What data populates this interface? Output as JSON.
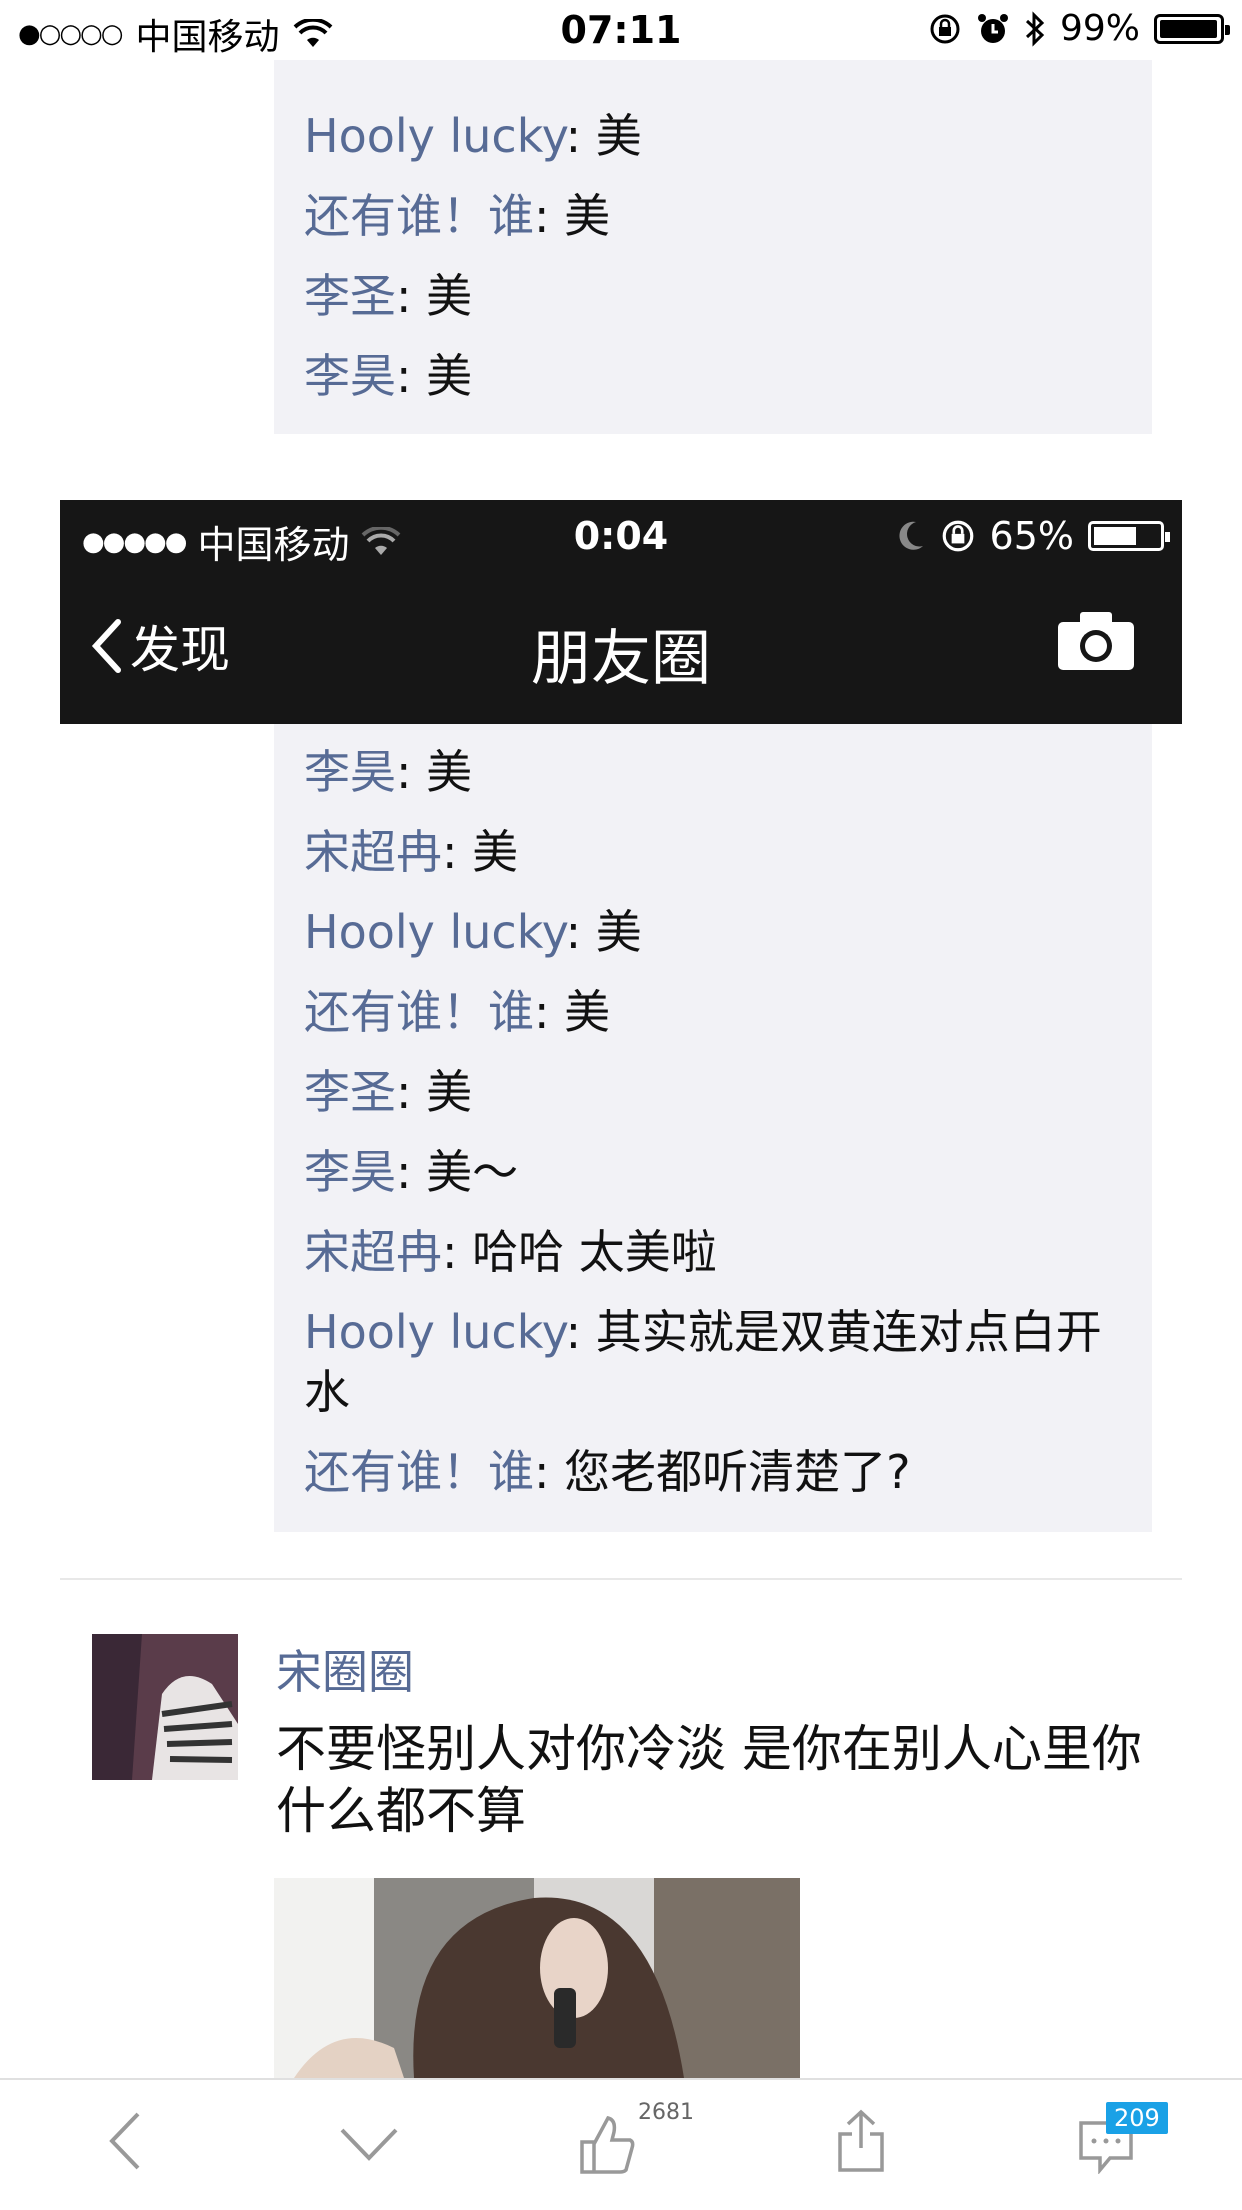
{
  "status_bar": {
    "signal": "●○○○○",
    "carrier": "中国移动",
    "time": "07:11",
    "battery": "99%",
    "battery_level": 0.99
  },
  "top_comments": [
    {
      "name": "Hooly lucky",
      "sep": ": ",
      "text": "美"
    },
    {
      "name": "还有谁！谁",
      "sep": ": ",
      "text": "美"
    },
    {
      "name": "李圣",
      "sep": ": ",
      "text": "美"
    },
    {
      "name": "李昊",
      "sep": ": ",
      "text": "美"
    }
  ],
  "inner_screen": {
    "signal": "●●●●●",
    "carrier": "中国移动",
    "time": "0:04",
    "battery": "65%",
    "battery_level": 0.65,
    "back_label": "发现",
    "title": "朋友圈"
  },
  "inner_comments": [
    {
      "name": "李昊",
      "sep": ": ",
      "text": "美"
    },
    {
      "name": "宋超冉",
      "sep": ": ",
      "text": "美"
    },
    {
      "name": "Hooly lucky",
      "sep": ": ",
      "text": "美"
    },
    {
      "name": "还有谁！谁",
      "sep": ": ",
      "text": "美"
    },
    {
      "name": "李圣",
      "sep": ": ",
      "text": "美"
    },
    {
      "name": "李昊",
      "sep": ": ",
      "text": "美～"
    },
    {
      "name": "宋超冉",
      "sep": ": ",
      "text": "哈哈 太美啦"
    },
    {
      "name": "Hooly lucky",
      "sep": ": ",
      "text": "其实就是双黄连对点白开水"
    },
    {
      "name": "还有谁！谁",
      "sep": ": ",
      "text": "您老都听清楚了?"
    }
  ],
  "post": {
    "author": "宋圈圈",
    "text": "不要怪别人对你冷淡 是你在别人心里你什么都不算"
  },
  "toolbar": {
    "like_count": "2681",
    "comment_count": "209"
  },
  "icons": [
    "wifi-icon",
    "lock-rotation-icon",
    "alarm-icon",
    "bluetooth-icon",
    "battery-icon",
    "moon-icon",
    "camera-icon",
    "back-chevron-icon",
    "down-chevron-icon",
    "thumbs-up-icon",
    "share-icon",
    "comment-icon"
  ]
}
